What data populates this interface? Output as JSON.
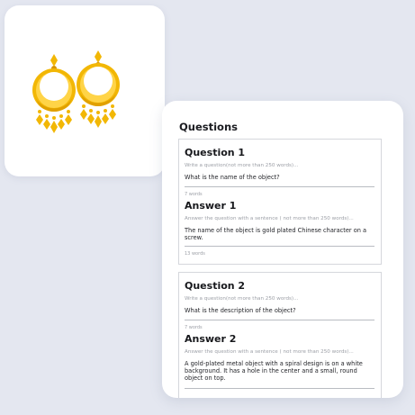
{
  "image_card": {
    "icon": "gold-earrings-icon",
    "colors": {
      "gold": "#f2b705",
      "gold_dark": "#d99400",
      "gold_light": "#ffd447"
    }
  },
  "qa_panel": {
    "heading": "Questions",
    "items": [
      {
        "question_title": "Question 1",
        "question_placeholder": "Write a question(not more than 250 words)...",
        "question_value": "What is the name of the object?",
        "question_count": "7 words",
        "answer_title": "Answer 1",
        "answer_placeholder": "Answer the question with a sentence ( not more than 250 words)...",
        "answer_value": "The name of the object is gold plated Chinese character on a screw.",
        "answer_count": "13 words"
      },
      {
        "question_title": "Question 2",
        "question_placeholder": "Write a question(not more than 250 words)...",
        "question_value": "What is the description of the object?",
        "question_count": "7 words",
        "answer_title": "Answer 2",
        "answer_placeholder": "Answer the question with a sentence ( not more than 250 words)...",
        "answer_value": "A gold-plated metal object with a spiral design is on a white background. It has a hole in the center and a small, round object on top."
      }
    ]
  }
}
